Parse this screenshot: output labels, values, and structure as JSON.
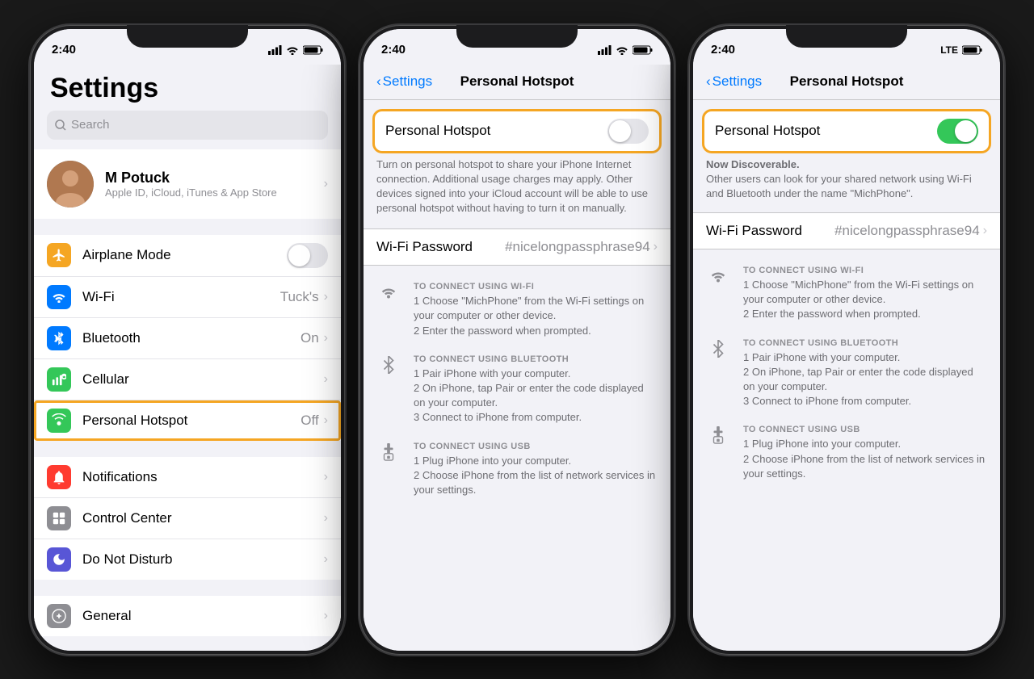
{
  "phone1": {
    "status": {
      "time": "2:40",
      "location": true
    },
    "title": "Settings",
    "search_placeholder": "Search",
    "profile": {
      "name": "M Potuck",
      "subtitle": "Apple ID, iCloud, iTunes & App Store"
    },
    "group1": [
      {
        "id": "airplane",
        "label": "Airplane Mode",
        "color": "#f5a623",
        "value": "",
        "toggle": "off"
      },
      {
        "id": "wifi",
        "label": "Wi-Fi",
        "color": "#007aff",
        "value": "Tuck's"
      },
      {
        "id": "bluetooth",
        "label": "Bluetooth",
        "color": "#007aff",
        "value": "On"
      },
      {
        "id": "cellular",
        "label": "Cellular",
        "color": "#34c759",
        "value": ""
      },
      {
        "id": "hotspot",
        "label": "Personal Hotspot",
        "color": "#34c759",
        "value": "Off",
        "highlighted": true
      }
    ],
    "group2": [
      {
        "id": "notifications",
        "label": "Notifications",
        "color": "#ff3b30"
      },
      {
        "id": "controlcenter",
        "label": "Control Center",
        "color": "#8e8e93"
      },
      {
        "id": "donotdisturb",
        "label": "Do Not Disturb",
        "color": "#5856d6"
      }
    ],
    "group3": [
      {
        "id": "general",
        "label": "General",
        "color": "#8e8e93"
      }
    ]
  },
  "phone2": {
    "status": {
      "time": "2:40"
    },
    "nav": {
      "back": "Settings",
      "title": "Personal Hotspot"
    },
    "toggle_label": "Personal Hotspot",
    "toggle_state": "off",
    "description": "Turn on personal hotspot to share your iPhone Internet connection. Additional usage charges may apply. Other devices signed into your iCloud account will be able to use personal hotspot without having to turn it on manually.",
    "wifi_password_label": "Wi-Fi Password",
    "wifi_password_value": "#nicelongpassphrase94",
    "connect_sections": [
      {
        "icon": "wifi",
        "heading": "TO CONNECT USING WI-FI",
        "steps": [
          "1 Choose \"MichPhone\" from the Wi-Fi settings on your computer or other device.",
          "2 Enter the password when prompted."
        ]
      },
      {
        "icon": "bluetooth",
        "heading": "TO CONNECT USING BLUETOOTH",
        "steps": [
          "1 Pair iPhone with your computer.",
          "2 On iPhone, tap Pair or enter the code displayed on your computer.",
          "3 Connect to iPhone from computer."
        ]
      },
      {
        "icon": "usb",
        "heading": "TO CONNECT USING USB",
        "steps": [
          "1 Plug iPhone into your computer.",
          "2 Choose iPhone from the list of network services in your settings."
        ]
      }
    ]
  },
  "phone3": {
    "status": {
      "time": "2:40",
      "carrier": "LTE"
    },
    "nav": {
      "back": "Settings",
      "title": "Personal Hotspot"
    },
    "toggle_label": "Personal Hotspot",
    "toggle_state": "on",
    "discoverable": "Now Discoverable.",
    "discoverable_detail": "Other users can look for your shared network using Wi-Fi and Bluetooth under the name \"MichPhone\".",
    "wifi_password_label": "Wi-Fi Password",
    "wifi_password_value": "#nicelongpassphrase94",
    "connect_sections": [
      {
        "icon": "wifi",
        "heading": "TO CONNECT USING WI-FI",
        "steps": [
          "1 Choose \"MichPhone\" from the Wi-Fi settings on your computer or other device.",
          "2 Enter the password when prompted."
        ]
      },
      {
        "icon": "bluetooth",
        "heading": "TO CONNECT USING BLUETOOTH",
        "steps": [
          "1 Pair iPhone with your computer.",
          "2 On iPhone, tap Pair or enter the code displayed on your computer.",
          "3 Connect to iPhone from computer."
        ]
      },
      {
        "icon": "usb",
        "heading": "TO CONNECT USING USB",
        "steps": [
          "1 Plug iPhone into your computer.",
          "2 Choose iPhone from the list of network services in your settings."
        ]
      }
    ]
  }
}
